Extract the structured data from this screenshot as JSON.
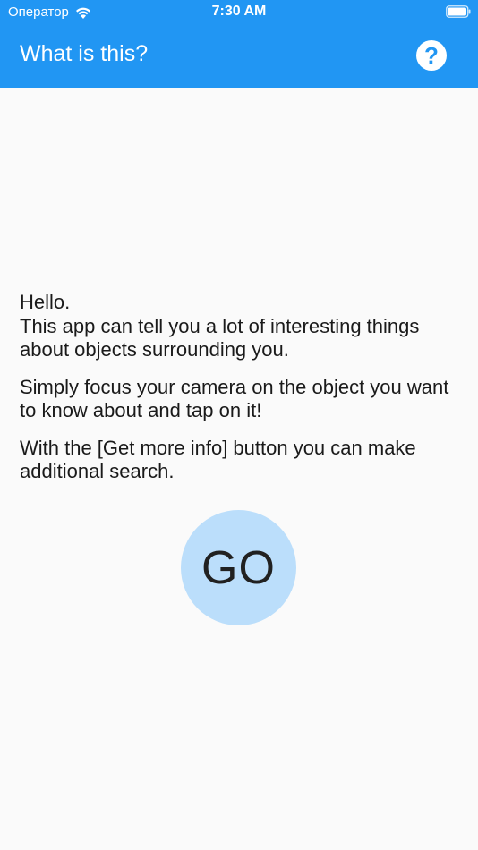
{
  "status_bar": {
    "carrier": "Оператор",
    "time": "7:30 AM",
    "wifi_icon": "wifi-icon",
    "battery_icon": "battery-icon"
  },
  "app_bar": {
    "title": "What is this?",
    "help_label": "?",
    "help_icon": "help-icon"
  },
  "intro": {
    "line1": "Hello.",
    "line2": "This app can tell you a lot of interesting things about objects surrounding you.",
    "paragraph2": "Simply focus your camera on the object you want to know about and tap on it!",
    "paragraph3": "With the [Get more info] button you can make additional search."
  },
  "go_button": {
    "label": "GO"
  },
  "colors": {
    "app_bar": "#2196f3",
    "background": "#fafafa",
    "go_button": "#bbdefb",
    "text": "#1a1a1a"
  }
}
